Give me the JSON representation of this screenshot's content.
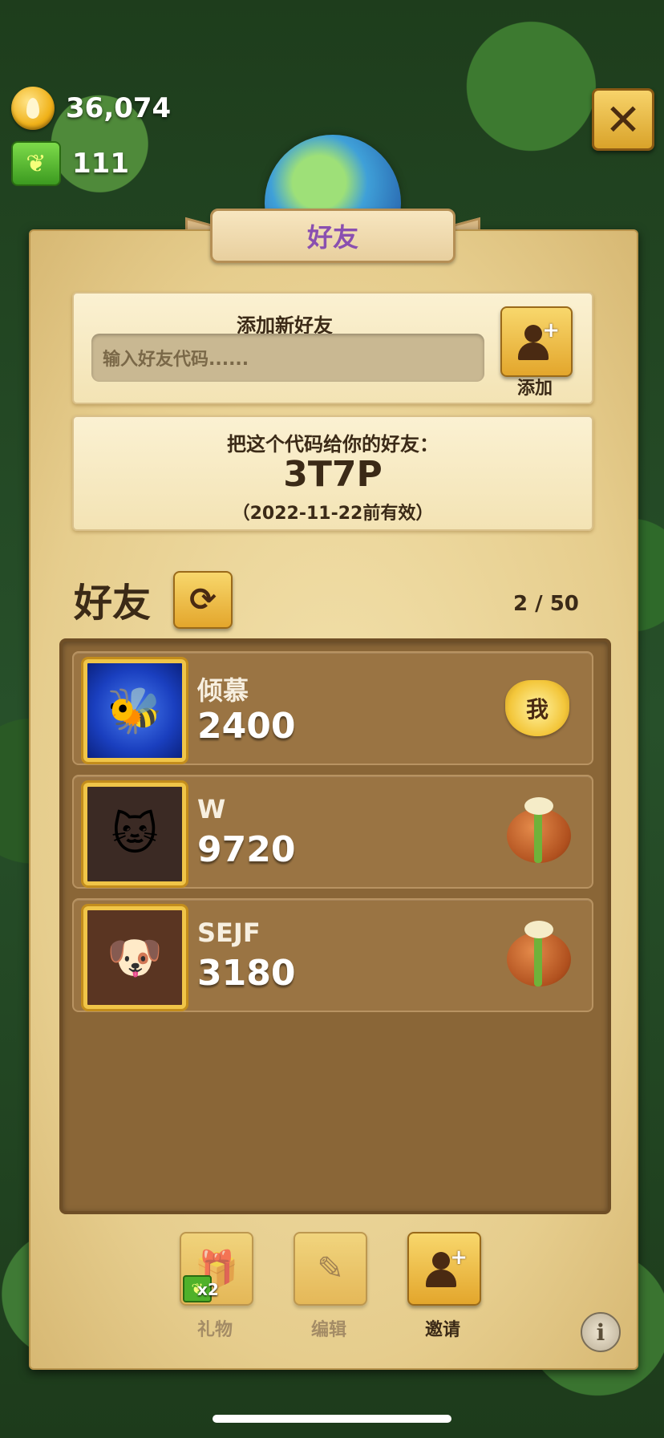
{
  "currencies": {
    "drops": {
      "value": "36,074",
      "icon": "drop-icon"
    },
    "butterflies": {
      "value": "111",
      "icon": "butterfly-icon"
    }
  },
  "close_icon": "✕",
  "header": {
    "title": "好友"
  },
  "add_friend": {
    "title": "添加新好友",
    "input_placeholder": "输入好友代码......",
    "add_button_label": "添加"
  },
  "share_code": {
    "title": "把这个代码给你的好友：",
    "code": "3T7P",
    "validity": "（2022-11-22前有效）"
  },
  "friends": {
    "title": "好友",
    "count": "2 / 50",
    "list": [
      {
        "name": "倾慕",
        "score": "2400",
        "badge": "我",
        "avatar": "bee-avatar"
      },
      {
        "name": "W",
        "score": "9720",
        "avatar": "cat-avatar",
        "action": "gift-bag-icon"
      },
      {
        "name": "SEJF",
        "score": "3180",
        "avatar": "dog-avatar",
        "action": "gift-bag-icon"
      }
    ]
  },
  "bottom_bar": {
    "gift": {
      "label": "礼物",
      "badge": "x2"
    },
    "edit": {
      "label": "编辑"
    },
    "invite": {
      "label": "邀请"
    }
  },
  "colors": {
    "accent": "#e3a62c",
    "panel": "#f3e2ad",
    "list_bg": "#8a6637",
    "title_purple": "#8a4fb0"
  }
}
